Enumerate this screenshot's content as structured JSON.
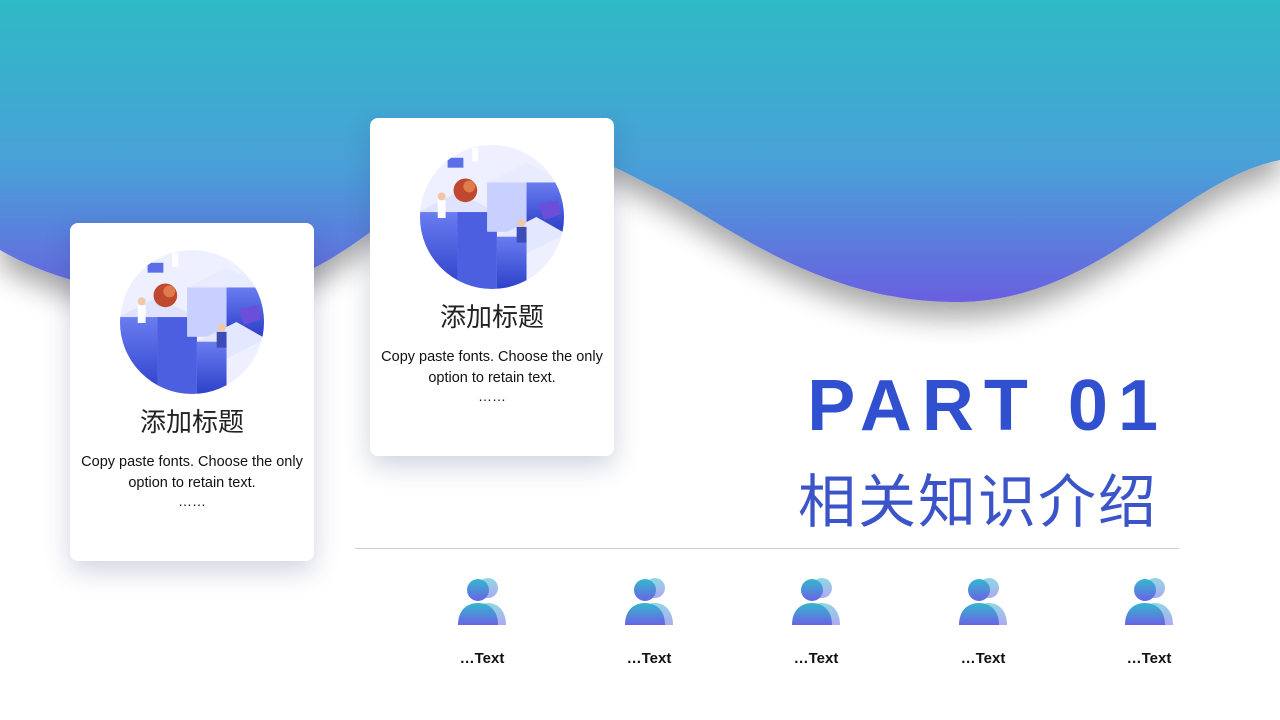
{
  "colors": {
    "wave_top": "#2dbac6",
    "wave_bottom": "#6a5fe0",
    "accent_blue": "#3050d0",
    "subtitle_blue": "#3b54c8",
    "icon_top": "#34b8cc",
    "icon_bottom": "#6a63e6"
  },
  "cards": [
    {
      "illustration_icon": "isometric-medical-illustration-icon",
      "title": "添加标题",
      "description": "Copy paste fonts. Choose the only option to retain text.",
      "ellipsis": "……"
    },
    {
      "illustration_icon": "isometric-medical-illustration-icon",
      "title": "添加标题",
      "description": "Copy paste fonts. Choose the only option to retain text.",
      "ellipsis": "……"
    }
  ],
  "section": {
    "part": "PART 01",
    "subtitle": "相关知识介绍"
  },
  "people": [
    {
      "icon": "people-group-icon",
      "label": "…Text"
    },
    {
      "icon": "people-group-icon",
      "label": "…Text"
    },
    {
      "icon": "people-group-icon",
      "label": "…Text"
    },
    {
      "icon": "people-group-icon",
      "label": "…Text"
    },
    {
      "icon": "people-group-icon",
      "label": "…Text"
    }
  ]
}
